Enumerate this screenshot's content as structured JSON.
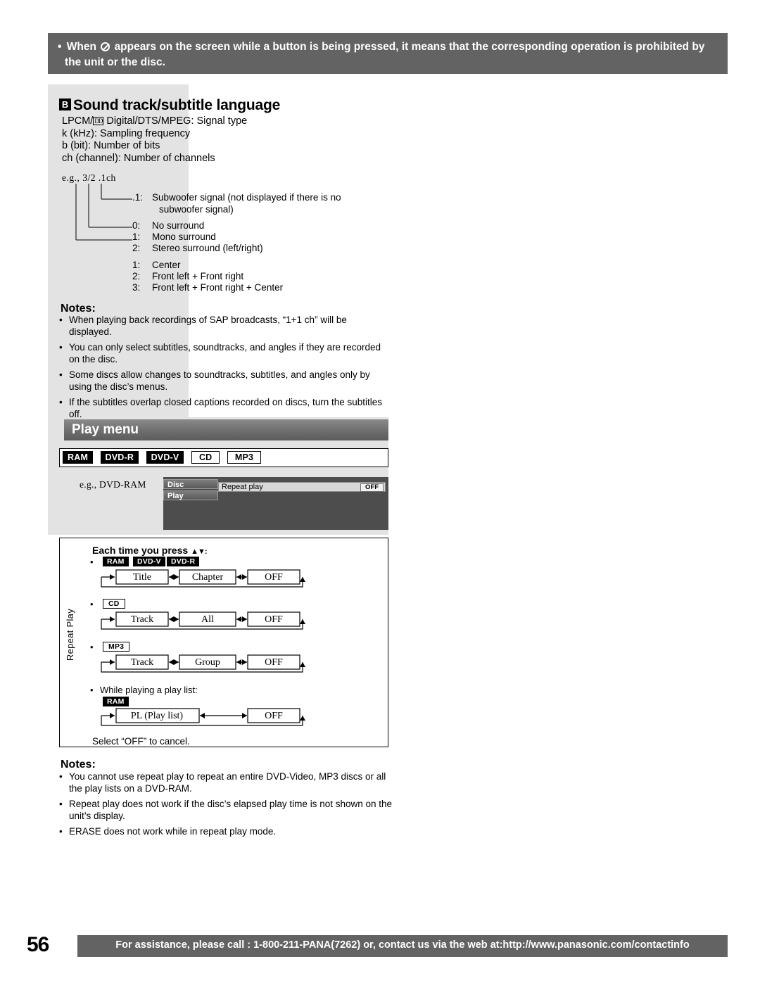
{
  "top_note": {
    "line1": "When      appears on the screen while a button is being pressed, it means that the corresponding operation is prohibited by",
    "line2": "the unit or the disc.",
    "bullet": "•"
  },
  "section_b": {
    "tag": "B",
    "title": "Sound track/subtitle language",
    "lines": [
      "LPCM/",
      " Digital/DTS/MPEG: Signal type",
      "k (kHz): Sampling frequency",
      "b (bit): Number of bits",
      "ch (channel): Number of channels"
    ],
    "dd_logo": "DD",
    "example": "e.g., 3/2 .1ch"
  },
  "diagram": {
    "sub_label": ".1:",
    "sub_text1": "Subwoofer signal (not displayed if there is no",
    "sub_text2": "subwoofer signal)",
    "surround": [
      {
        "num": "0:",
        "text": "No surround"
      },
      {
        "num": "1:",
        "text": "Mono surround"
      },
      {
        "num": "2:",
        "text": "Stereo surround (left/right)"
      }
    ],
    "front": [
      {
        "num": "1:",
        "text": "Center"
      },
      {
        "num": "2:",
        "text": "Front left + Front right"
      },
      {
        "num": "3:",
        "text": "Front left + Front right + Center"
      }
    ]
  },
  "notes1": {
    "title": "Notes:",
    "items": [
      "When playing back recordings of SAP broadcasts, “1+1 ch” will be displayed.",
      "You can only select subtitles, soundtracks, and angles if they are recorded on the disc.",
      "Some discs allow changes to soundtracks, subtitles, and angles only by using the disc’s menus.",
      "If the subtitles overlap closed captions recorded on discs, turn the subtitles off."
    ]
  },
  "play_menu": {
    "title": "Play menu",
    "media_tags": [
      "RAM",
      "DVD-R",
      "DVD-V",
      "CD",
      "MP3"
    ],
    "example_label": "e.g., DVD-RAM"
  },
  "osd": {
    "tab_disc": "Disc",
    "tab_play": "Play",
    "row_label": "Repeat play",
    "row_value": "OFF"
  },
  "repeat_play": {
    "heading": "Each time you press",
    "heading_arrows": "▲▼:",
    "side_label": "Repeat Play",
    "bullet": "•",
    "rows": [
      {
        "tags": [
          "RAM",
          "DVD-V",
          "DVD-R"
        ],
        "steps": [
          "Title",
          "Chapter",
          "OFF"
        ]
      },
      {
        "tags": [
          "CD"
        ],
        "steps": [
          "Track",
          "All",
          "OFF"
        ]
      },
      {
        "tags": [
          "MP3"
        ],
        "steps": [
          "Track",
          "Group",
          "OFF"
        ]
      }
    ],
    "playlist_note": "While playing a play list:",
    "playlist_tag": "RAM",
    "playlist_steps": [
      "PL (Play list)",
      "OFF"
    ],
    "select_text": "Select “OFF” to cancel."
  },
  "notes2": {
    "title": "Notes:",
    "items": [
      "You cannot use repeat play to repeat an entire DVD-Video, MP3 discs or all the play lists on a DVD-RAM.",
      "Repeat play does not work if the disc’s elapsed play time is not shown on the unit’s display.",
      "ERASE does not work while in repeat play mode."
    ]
  },
  "footer": {
    "page_number": "56",
    "text": "For assistance, please call : 1-800-211-PANA(7262) or, contact us via the web at:http://www.panasonic.com/contactinfo"
  }
}
